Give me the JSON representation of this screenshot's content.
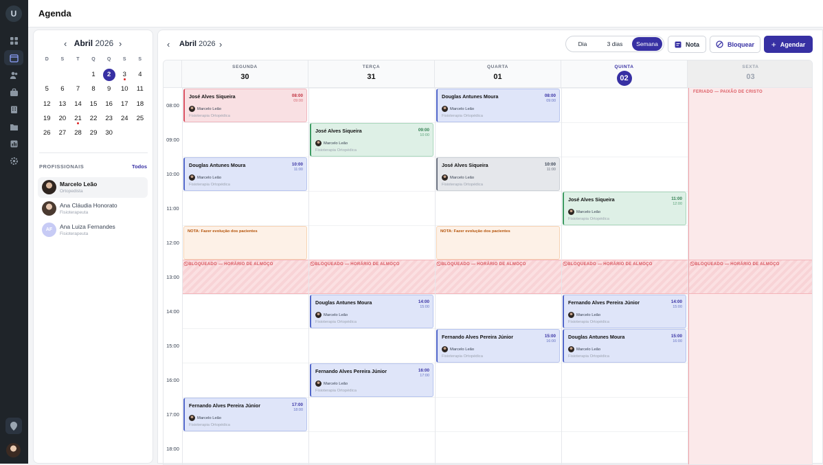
{
  "app": {
    "title": "Agenda",
    "logo_letter": "U"
  },
  "sidebar_icons": [
    "dashboard-icon",
    "calendar-icon",
    "users-icon",
    "briefcase-icon",
    "building-icon",
    "folder-icon",
    "report-icon",
    "settings-icon"
  ],
  "mini_calendar": {
    "month": "Abril",
    "year": "2026",
    "dow": [
      "D",
      "S",
      "T",
      "Q",
      "Q",
      "S",
      "S"
    ],
    "weeks": [
      [
        "",
        "",
        "",
        "1",
        "2",
        "3",
        "4"
      ],
      [
        "5",
        "6",
        "7",
        "8",
        "9",
        "10",
        "11"
      ],
      [
        "12",
        "13",
        "14",
        "15",
        "16",
        "17",
        "18"
      ],
      [
        "19",
        "20",
        "21",
        "22",
        "23",
        "24",
        "25"
      ],
      [
        "26",
        "27",
        "28",
        "29",
        "30",
        "",
        ""
      ]
    ],
    "selected": "2",
    "dots": [
      "3",
      "21"
    ]
  },
  "professionals": {
    "label": "PROFISSIONAIS",
    "all_label": "Todos",
    "items": [
      {
        "name": "Marcelo Leão",
        "role": "Ortopedista"
      },
      {
        "name": "Ana Cláudia Honorato",
        "role": "Fisioterapeuta"
      },
      {
        "name": "Ana Luiza Fernandes",
        "role": "Fisioterapeuta",
        "initials": "AF"
      }
    ]
  },
  "week": {
    "month": "Abril",
    "year": "2026"
  },
  "views": [
    "Dia",
    "3 dias",
    "Semana"
  ],
  "actions": {
    "note": "Nota",
    "block": "Bloquear",
    "schedule": "Agendar"
  },
  "days": [
    {
      "name": "SEGUNDA",
      "num": "30"
    },
    {
      "name": "TERÇA",
      "num": "31"
    },
    {
      "name": "QUARTA",
      "num": "01"
    },
    {
      "name": "QUINTA",
      "num": "02"
    },
    {
      "name": "SEXTA",
      "num": "03"
    }
  ],
  "hours": [
    "08:00",
    "09:00",
    "10:00",
    "11:00",
    "12:00",
    "13:00",
    "14:00",
    "15:00",
    "16:00",
    "17:00",
    "18:00"
  ],
  "holiday_label": "FERIADO — PAIXÃO DE CRISTO",
  "block_label": "BLOQUEADO — HORÁRIO DE ALMOÇO",
  "note_label": "NOTA: Fazer evolução dos pacientes",
  "event_professional": "Marcelo Leão",
  "event_specialty": "Fisioterapia Ortopédica",
  "events": [
    {
      "day": 0,
      "patient": "José Alves Siqueira",
      "start": "08:00",
      "end": "09:00",
      "color": "pink"
    },
    {
      "day": 0,
      "patient": "Douglas Antunes Moura",
      "start": "10:00",
      "end": "11:00",
      "color": "blue"
    },
    {
      "day": 0,
      "patient": "Fernando Alves Pereira Júnior",
      "start": "17:00",
      "end": "18:00",
      "color": "blue"
    },
    {
      "day": 1,
      "patient": "José Alves Siqueira",
      "start": "09:00",
      "end": "10:00",
      "color": "green"
    },
    {
      "day": 1,
      "patient": "Douglas Antunes Moura",
      "start": "14:00",
      "end": "15:00",
      "color": "blue"
    },
    {
      "day": 1,
      "patient": "Fernando Alves Pereira Júnior",
      "start": "16:00",
      "end": "17:00",
      "color": "blue"
    },
    {
      "day": 2,
      "patient": "Douglas Antunes Moura",
      "start": "08:00",
      "end": "09:00",
      "color": "blue"
    },
    {
      "day": 2,
      "patient": "José Alves Siqueira",
      "start": "10:00",
      "end": "11:00",
      "color": "gray"
    },
    {
      "day": 2,
      "patient": "Fernando Alves Pereira Júnior",
      "start": "15:00",
      "end": "16:00",
      "color": "blue"
    },
    {
      "day": 3,
      "patient": "José Alves Siqueira",
      "start": "11:00",
      "end": "12:00",
      "color": "green"
    },
    {
      "day": 3,
      "patient": "Fernando Alves Pereira Júnior",
      "start": "14:00",
      "end": "15:00",
      "color": "blue"
    },
    {
      "day": 3,
      "patient": "Douglas Antunes Moura",
      "start": "15:00",
      "end": "16:00",
      "color": "blue"
    }
  ],
  "notes": [
    {
      "day": 0
    },
    {
      "day": 2
    }
  ],
  "blocks": [
    {
      "day": 0
    },
    {
      "day": 1
    },
    {
      "day": 2
    },
    {
      "day": 3
    },
    {
      "day": 4
    }
  ]
}
